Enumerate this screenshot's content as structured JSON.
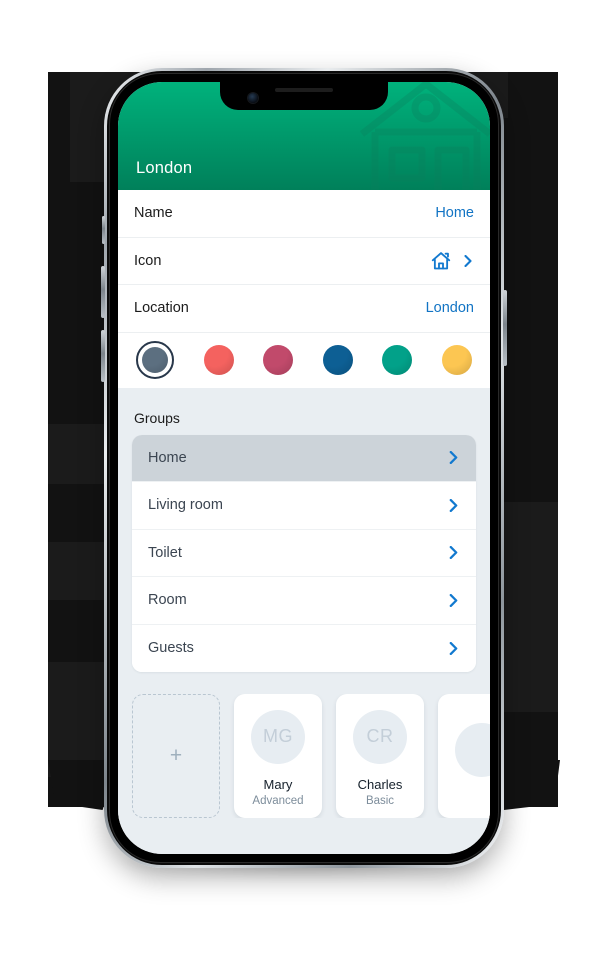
{
  "header": {
    "title": "London",
    "watermark_icon": "house-outline-icon",
    "gradient_top": "#00b27c",
    "gradient_bottom": "#00805a"
  },
  "detail_rows": [
    {
      "label": "Name",
      "value": "Home",
      "accessory": "none"
    },
    {
      "label": "Icon",
      "value": "",
      "accessory": "house-icon-and-chevron"
    },
    {
      "label": "Location",
      "value": "London",
      "accessory": "none"
    }
  ],
  "colors": {
    "accent_link": "#1274c4",
    "swatches": [
      {
        "name": "slate",
        "hex": "#5c6f80",
        "selected": true
      },
      {
        "name": "red",
        "hex": "#f4625f",
        "selected": false
      },
      {
        "name": "magenta",
        "hex": "#c14a6b",
        "selected": false
      },
      {
        "name": "blue",
        "hex": "#0d5f94",
        "selected": false
      },
      {
        "name": "teal",
        "hex": "#02a189",
        "selected": false
      },
      {
        "name": "yellow",
        "hex": "#fcc652",
        "selected": false
      }
    ]
  },
  "groups": {
    "section_title": "Groups",
    "items": [
      {
        "label": "Home",
        "selected": true
      },
      {
        "label": "Living room",
        "selected": false
      },
      {
        "label": "Toilet",
        "selected": false
      },
      {
        "label": "Room",
        "selected": false
      },
      {
        "label": "Guests",
        "selected": false
      }
    ]
  },
  "users": {
    "add_label": "+",
    "cards": [
      {
        "initials": "MG",
        "name": "Mary",
        "role": "Advanced"
      },
      {
        "initials": "CR",
        "name": "Charles",
        "role": "Basic"
      },
      {
        "initials": "",
        "name": "",
        "role": ""
      }
    ]
  }
}
